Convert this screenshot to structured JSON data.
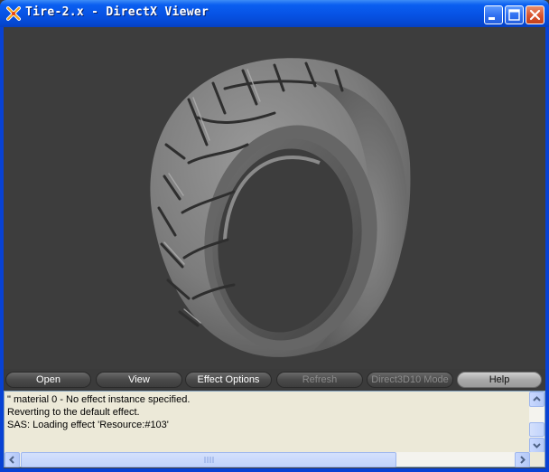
{
  "window": {
    "title": "Tire-2.x - DirectX Viewer"
  },
  "toolbar": {
    "buttons": [
      {
        "label": "Open",
        "enabled": true
      },
      {
        "label": "View",
        "enabled": true
      },
      {
        "label": "Effect Options",
        "enabled": true
      },
      {
        "label": "Refresh",
        "enabled": false
      },
      {
        "label": "Direct3D10 Mode",
        "enabled": false
      },
      {
        "label": "Help",
        "enabled": true,
        "highlighted": true
      }
    ]
  },
  "log": {
    "lines": [
      "\" material 0 - No effect instance specified.",
      "Reverting to the default effect.",
      "SAS: Loading effect 'Resource:#103'"
    ]
  },
  "viewport": {
    "object": "tire-model",
    "background_color": "#3d3d3d",
    "model_color": "#8a8a8a"
  },
  "colors": {
    "titlebar": "#0754e6",
    "close_button": "#d8522d",
    "log_background": "#ece9d8",
    "scrollbar_thumb": "#c1d3fb"
  },
  "icons": {
    "app": "directx-icon",
    "minimize": "minimize-icon",
    "maximize": "maximize-icon",
    "close": "close-icon"
  }
}
